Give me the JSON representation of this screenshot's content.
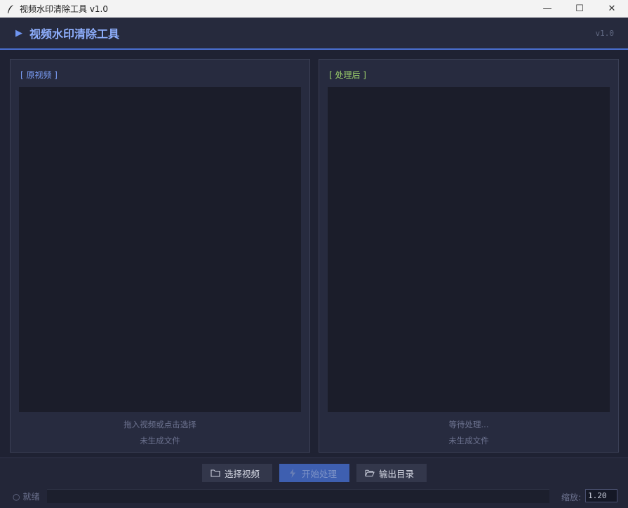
{
  "window": {
    "title": "视频水印清除工具 v1.0",
    "min_glyph": "—",
    "max_glyph": "☐",
    "close_glyph": "✕"
  },
  "header": {
    "title": "视频水印清除工具",
    "version": "v1.0",
    "play_glyph": "▶"
  },
  "left_panel": {
    "title": "[ 原视频 ]",
    "hint": "拖入视频或点击选择",
    "file_status": "未生成文件"
  },
  "right_panel": {
    "title": "[ 处理后 ]",
    "hint": "等待处理...",
    "file_status": "未生成文件"
  },
  "toolbar": {
    "select_label": "选择视频",
    "start_label": "开始处理",
    "output_label": "输出目录"
  },
  "status": {
    "dot": "○",
    "text": "就绪"
  },
  "progress": {
    "value": 0
  },
  "zoom": {
    "label": "缩放:",
    "value": "1.20"
  },
  "colors": {
    "accent": "#4a6fd0",
    "left_title": "#7b9df5",
    "right_title": "#9ed36c"
  }
}
